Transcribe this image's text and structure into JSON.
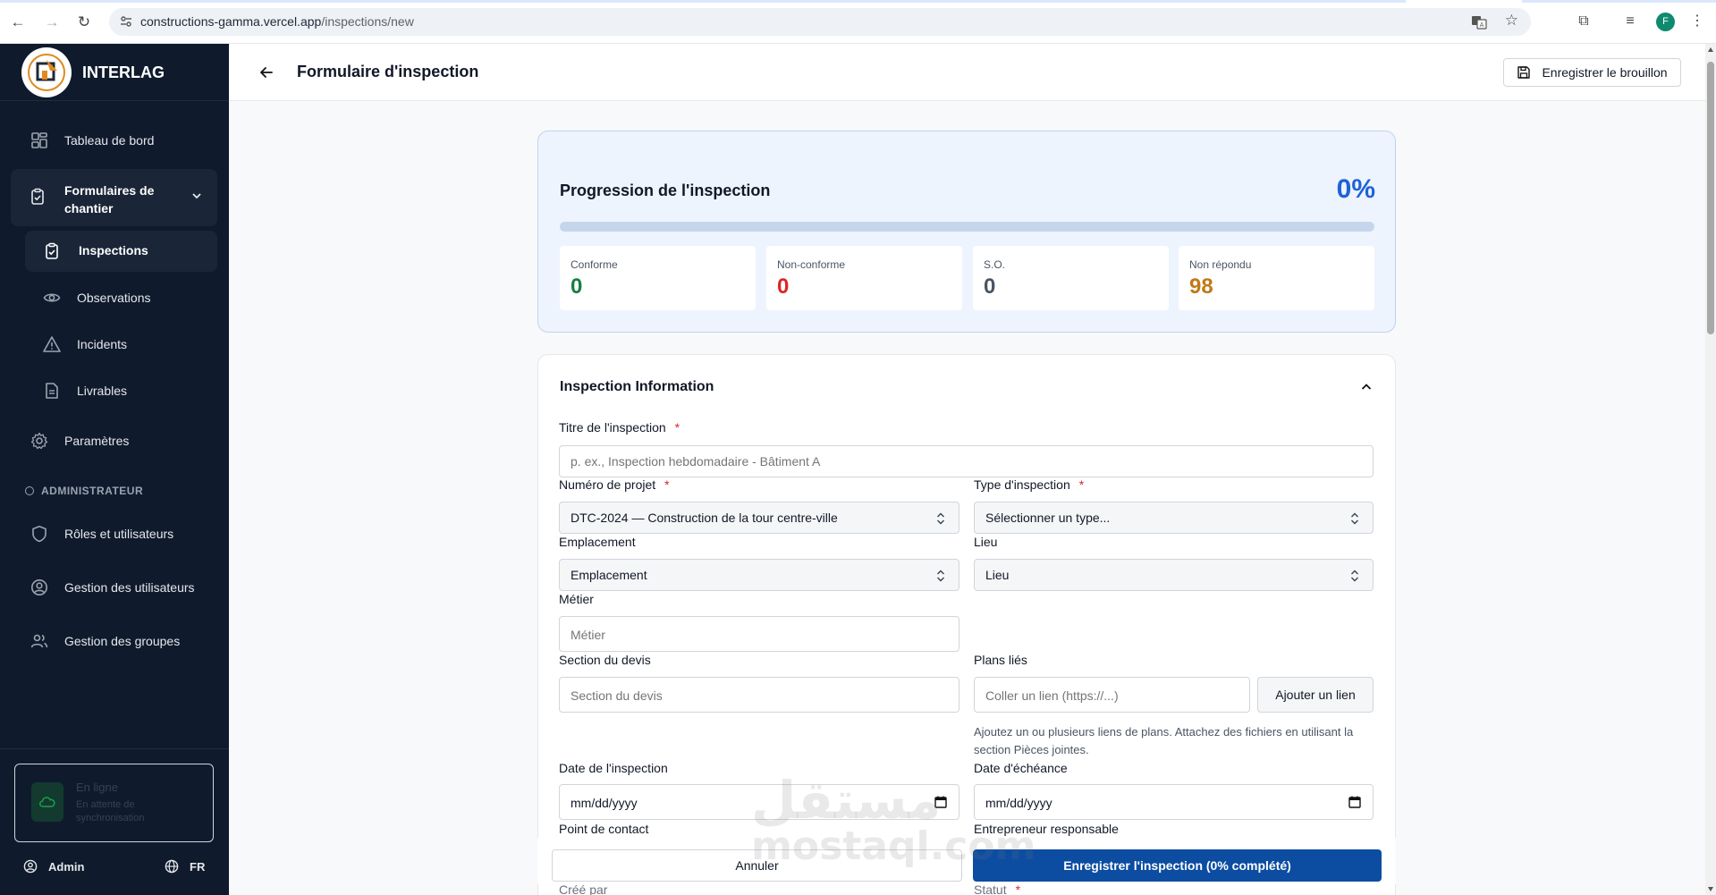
{
  "browser": {
    "url_host": "constructions-gamma.vercel.app",
    "url_path": "/inspections/new",
    "profile_initial": "F"
  },
  "sidebar": {
    "brand": "INTERLAG",
    "items": [
      {
        "label": "Tableau de bord",
        "icon": "dashboard-icon"
      },
      {
        "label": "Formulaires de chantier",
        "icon": "clipboard-check-icon"
      },
      {
        "label": "Inspections",
        "icon": "clipboard-check-icon"
      },
      {
        "label": "Observations",
        "icon": "eye-icon"
      },
      {
        "label": "Incidents",
        "icon": "warning-icon"
      },
      {
        "label": "Livrables",
        "icon": "document-icon"
      },
      {
        "label": "Paramètres",
        "icon": "gear-icon"
      }
    ],
    "admin_section": "ADMINISTRATEUR",
    "admin_items": [
      {
        "label": "Rôles et utilisateurs",
        "icon": "shield-icon"
      },
      {
        "label": "Gestion des utilisateurs",
        "icon": "user-circle-icon"
      },
      {
        "label": "Gestion des groupes",
        "icon": "users-icon"
      }
    ],
    "status": {
      "title": "En ligne",
      "subtitle": "En attente de synchronisation"
    },
    "user": "Admin",
    "lang": "FR"
  },
  "header": {
    "title": "Formulaire d'inspection",
    "draft_button": "Enregistrer le brouillon"
  },
  "progress": {
    "heading": "Progression de l'inspection",
    "percent_label": "0%",
    "percent": 0,
    "stats": [
      {
        "label": "Conforme",
        "value": "0",
        "color": "#15803d"
      },
      {
        "label": "Non-conforme",
        "value": "0",
        "color": "#dc2626"
      },
      {
        "label": "S.O.",
        "value": "0",
        "color": "#4b5563"
      },
      {
        "label": "Non répondu",
        "value": "98",
        "color": "#c2781a"
      }
    ]
  },
  "form": {
    "heading": "Inspection Information",
    "title_label": "Titre de l'inspection",
    "title_placeholder": "p. ex., Inspection hebdomadaire - Bâtiment A",
    "project_label": "Numéro de projet",
    "project_value": "DTC-2024 — Construction de la tour centre-ville",
    "type_label": "Type d'inspection",
    "type_value": "Sélectionner un type...",
    "location_label": "Emplacement",
    "location_value": "Emplacement",
    "place_label": "Lieu",
    "place_value": "Lieu",
    "trade_label": "Métier",
    "trade_placeholder": "Métier",
    "spec_label": "Section du devis",
    "spec_placeholder": "Section du devis",
    "plans_label": "Plans liés",
    "plans_placeholder": "Coller un lien (https://...)",
    "plans_button": "Ajouter un lien",
    "plans_helper": "Ajoutez un ou plusieurs liens de plans. Attachez des fichiers en utilisant la section Pièces jointes.",
    "date_label": "Date de l'inspection",
    "date_value": "mm/dd/yyyy",
    "due_label": "Date d'échéance",
    "due_value": "mm/dd/yyyy",
    "contact_label": "Point de contact",
    "contractor_label": "Entrepreneur responsable",
    "created_label": "Créé par",
    "status_label": "Statut",
    "required_mark": "*"
  },
  "actions": {
    "cancel": "Annuler",
    "save": "Enregistrer l'inspection (0% complété)"
  },
  "watermark": {
    "arabic": "مستقل",
    "latin": "mostaql.com"
  }
}
